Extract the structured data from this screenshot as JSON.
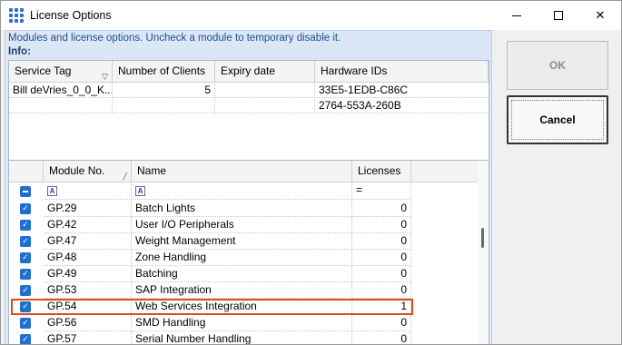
{
  "window": {
    "title": "License Options",
    "minimize_glyph": "",
    "maximize_glyph": "",
    "close_glyph": "✕"
  },
  "description": "Modules and license options. Uncheck a module to temporary disable it.",
  "info": {
    "label": "Info:",
    "columns": [
      "Service Tag",
      "Number of Clients",
      "Expiry date",
      "Hardware IDs"
    ],
    "rows": [
      {
        "service_tag": "Bill deVries_0_0_K...",
        "clients": "5",
        "expiry": "",
        "hardware_id": "33E5-1EDB-C86C"
      },
      {
        "service_tag": "",
        "clients": "",
        "expiry": "",
        "hardware_id": "2764-553A-260B"
      }
    ]
  },
  "modules": {
    "columns": [
      "Module No.",
      "Name",
      "Licenses"
    ],
    "filter_placeholder_a": "A",
    "filter_equals": "=",
    "rows": [
      {
        "module_no": "GP.29",
        "name": "Batch Lights",
        "licenses": "0",
        "checked": true
      },
      {
        "module_no": "GP.42",
        "name": "User I/O Peripherals",
        "licenses": "0",
        "checked": true
      },
      {
        "module_no": "GP.47",
        "name": "Weight Management",
        "licenses": "0",
        "checked": true
      },
      {
        "module_no": "GP.48",
        "name": "Zone Handling",
        "licenses": "0",
        "checked": true
      },
      {
        "module_no": "GP.49",
        "name": "Batching",
        "licenses": "0",
        "checked": true
      },
      {
        "module_no": "GP.53",
        "name": "SAP Integration",
        "licenses": "0",
        "checked": true
      },
      {
        "module_no": "GP.54",
        "name": "Web Services Integration",
        "licenses": "1",
        "checked": true,
        "selected": true
      },
      {
        "module_no": "GP.56",
        "name": "SMD Handling",
        "licenses": "0",
        "checked": true
      },
      {
        "module_no": "GP.57",
        "name": "Serial Number Handling",
        "licenses": "0",
        "checked": true
      }
    ]
  },
  "buttons": {
    "ok": "OK",
    "cancel": "Cancel"
  },
  "colors": {
    "accent": "#1f6fcf",
    "selection_border": "#e04a1c",
    "panel_background": "#dbe7f7"
  }
}
